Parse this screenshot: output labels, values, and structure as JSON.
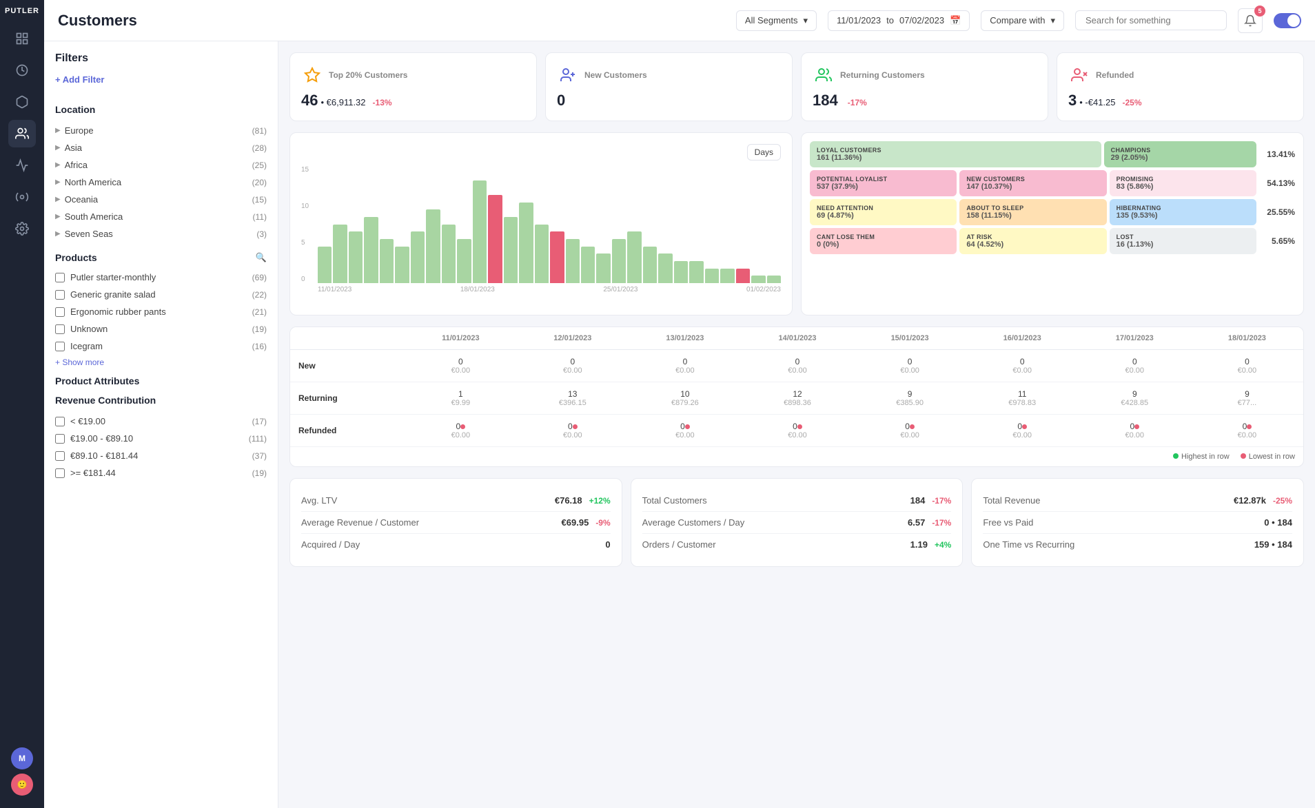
{
  "app": {
    "name": "PUTLER",
    "page_title": "Customers"
  },
  "header": {
    "segment_label": "All Segments",
    "date_from": "11/01/2023",
    "date_to": "07/02/2023",
    "compare_label": "Compare with",
    "search_placeholder": "Search for something",
    "notification_count": "5"
  },
  "filters": {
    "title": "Filters",
    "add_filter_label": "+ Add Filter",
    "location_title": "Location",
    "locations": [
      {
        "name": "Europe",
        "count": "(81)"
      },
      {
        "name": "Asia",
        "count": "(28)"
      },
      {
        "name": "Africa",
        "count": "(25)"
      },
      {
        "name": "North America",
        "count": "(20)"
      },
      {
        "name": "Oceania",
        "count": "(15)"
      },
      {
        "name": "South America",
        "count": "(11)"
      },
      {
        "name": "Seven Seas",
        "count": "(3)"
      }
    ],
    "products_title": "Products",
    "products": [
      {
        "name": "Putler starter-monthly",
        "count": "(69)"
      },
      {
        "name": "Generic granite salad",
        "count": "(22)"
      },
      {
        "name": "Ergonomic rubber pants",
        "count": "(21)"
      },
      {
        "name": "Unknown",
        "count": "(19)"
      },
      {
        "name": "Icegram",
        "count": "(16)"
      }
    ],
    "show_more_label": "+ Show more",
    "product_attributes_title": "Product Attributes",
    "revenue_title": "Revenue Contribution",
    "revenue_ranges": [
      {
        "name": "< €19.00",
        "count": "(17)"
      },
      {
        "name": "€19.00 - €89.10",
        "count": "(111)"
      },
      {
        "name": "€89.10 - €181.44",
        "count": "(37)"
      },
      {
        "name": ">= €181.44",
        "count": "(19)"
      }
    ]
  },
  "kpis": [
    {
      "label": "Top 20% Customers",
      "value": "46",
      "sub": "• €6,911.32",
      "badge": "-13%",
      "badge_type": "neg",
      "icon": "star"
    },
    {
      "label": "New Customers",
      "value": "0",
      "sub": "",
      "badge": "",
      "badge_type": "",
      "icon": "person-add"
    },
    {
      "label": "Returning Customers",
      "value": "184",
      "sub": "",
      "badge": "-17%",
      "badge_type": "neg",
      "icon": "refresh-person"
    },
    {
      "label": "Refunded",
      "value": "3",
      "sub": "• -€41.25",
      "badge": "-25%",
      "badge_type": "neg",
      "icon": "refund-person"
    }
  ],
  "chart": {
    "days_label": "Days",
    "x_labels": [
      "11/01/2023",
      "18/01/2023",
      "25/01/2023",
      "01/02/2023"
    ],
    "bars": [
      5,
      8,
      7,
      9,
      6,
      5,
      7,
      10,
      8,
      6,
      14,
      12,
      9,
      11,
      8,
      7,
      6,
      5,
      4,
      6,
      7,
      5,
      4,
      3,
      3,
      2,
      2,
      2,
      1,
      1
    ],
    "red_bars": [
      11,
      15,
      27
    ]
  },
  "segments": [
    {
      "row": [
        {
          "name": "LOYAL CUSTOMERS",
          "val": "161 (11.36%)",
          "color": "seg-green",
          "span": 2
        },
        {
          "name": "CHAMPIONS",
          "val": "29 (2.05%)",
          "color": "seg-lightgreen",
          "span": 1
        }
      ],
      "pct": "13.41%"
    },
    {
      "row": [
        {
          "name": "POTENTIAL LOYALIST",
          "val": "537 (37.9%)",
          "color": "seg-pink",
          "span": 1
        },
        {
          "name": "NEW CUSTOMERS",
          "val": "147 (10.37%)",
          "color": "seg-lightpink",
          "span": 1
        },
        {
          "name": "PROMISING",
          "val": "83 (5.86%)",
          "color": "seg-lightpink",
          "span": 1
        }
      ],
      "pct": "54.13%"
    },
    {
      "row": [
        {
          "name": "NEED ATTENTION",
          "val": "69 (4.87%)",
          "color": "seg-yellow",
          "span": 1
        },
        {
          "name": "ABOUT TO SLEEP",
          "val": "158 (11.15%)",
          "color": "seg-orange",
          "span": 1
        },
        {
          "name": "HIBERNATING",
          "val": "135 (9.53%)",
          "color": "seg-blue",
          "span": 1
        }
      ],
      "pct": "25.55%"
    },
    {
      "row": [
        {
          "name": "CANT LOSE THEM",
          "val": "0 (0%)",
          "color": "seg-red",
          "span": 1
        },
        {
          "name": "AT RISK",
          "val": "64 (4.52%)",
          "color": "seg-lightyellow",
          "span": 1
        },
        {
          "name": "LOST",
          "val": "16 (1.13%)",
          "color": "seg-gray",
          "span": 1
        }
      ],
      "pct": "5.65%"
    }
  ],
  "table": {
    "columns": [
      "",
      "11/01/2023",
      "12/01/2023",
      "13/01/2023",
      "14/01/2023",
      "15/01/2023",
      "16/01/2023",
      "17/01/2023",
      "18/01/2023"
    ],
    "rows": [
      {
        "label": "New",
        "cells": [
          {
            "val": "0",
            "sub": "€0.00"
          },
          {
            "val": "0",
            "sub": "€0.00"
          },
          {
            "val": "0",
            "sub": "€0.00"
          },
          {
            "val": "0",
            "sub": "€0.00"
          },
          {
            "val": "0",
            "sub": "€0.00"
          },
          {
            "val": "0",
            "sub": "€0.00"
          },
          {
            "val": "0",
            "sub": "€0.00"
          },
          {
            "val": "0",
            "sub": "€0.00"
          }
        ]
      },
      {
        "label": "Returning",
        "cells": [
          {
            "val": "1",
            "sub": "€9.99"
          },
          {
            "val": "13",
            "sub": "€396.15"
          },
          {
            "val": "10",
            "sub": "€879.26"
          },
          {
            "val": "12",
            "sub": "€898.36"
          },
          {
            "val": "9",
            "sub": "€385.90"
          },
          {
            "val": "11",
            "sub": "€978.83"
          },
          {
            "val": "9",
            "sub": "€428.85"
          },
          {
            "val": "9",
            "sub": "€77..."
          }
        ]
      },
      {
        "label": "Refunded",
        "cells": [
          {
            "val": "0",
            "sub": "€0.00",
            "dot": true
          },
          {
            "val": "0",
            "sub": "€0.00",
            "dot": true
          },
          {
            "val": "0",
            "sub": "€0.00",
            "dot": true
          },
          {
            "val": "0",
            "sub": "€0.00",
            "dot": true
          },
          {
            "val": "0",
            "sub": "€0.00",
            "dot": true
          },
          {
            "val": "0",
            "sub": "€0.00",
            "dot": true
          },
          {
            "val": "0",
            "sub": "€0.00",
            "dot": true
          },
          {
            "val": "0",
            "sub": "€0.00",
            "dot": true
          }
        ]
      }
    ],
    "legend": [
      {
        "label": "Highest in row",
        "color": "#22c55e"
      },
      {
        "label": "Lowest in row",
        "color": "#e85d75"
      }
    ]
  },
  "stats_left": {
    "items": [
      {
        "label": "Avg. LTV",
        "value": "€76.18",
        "badge": "+12%",
        "badge_type": "pos"
      },
      {
        "label": "Average Revenue / Customer",
        "value": "€69.95",
        "badge": "-9%",
        "badge_type": "neg"
      },
      {
        "label": "Acquired / Day",
        "value": "0",
        "badge": "",
        "badge_type": ""
      }
    ]
  },
  "stats_mid": {
    "items": [
      {
        "label": "Total Customers",
        "value": "184",
        "badge": "-17%",
        "badge_type": "neg"
      },
      {
        "label": "Average Customers / Day",
        "value": "6.57",
        "badge": "-17%",
        "badge_type": "neg"
      },
      {
        "label": "Orders / Customer",
        "value": "1.19",
        "badge": "+4%",
        "badge_type": "pos"
      }
    ]
  },
  "stats_right": {
    "items": [
      {
        "label": "Total Revenue",
        "value": "€12.87k",
        "badge": "-25%",
        "badge_type": "neg"
      },
      {
        "label": "Free vs Paid",
        "value": "0 • 184",
        "badge": "",
        "badge_type": ""
      },
      {
        "label": "One Time vs Recurring",
        "value": "159 • 184",
        "badge": "",
        "badge_type": ""
      }
    ]
  }
}
